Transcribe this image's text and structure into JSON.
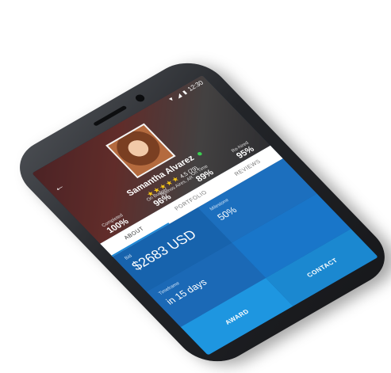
{
  "statusbar": {
    "time": "12:30"
  },
  "profile": {
    "name": "Samantha Alvarez",
    "rating_value": "4.5 (79)",
    "stars": "★★★★★",
    "subtitle": "Buenos Aires, AR"
  },
  "stats": [
    {
      "label": "Completed",
      "value": "100%"
    },
    {
      "label": "On Budget",
      "value": "96%"
    },
    {
      "label": "On Time",
      "value": "89%"
    },
    {
      "label": "Re-hired",
      "value": "95%"
    }
  ],
  "tabs": [
    "ABOUT",
    "PORTFOLIO",
    "REVIEWS"
  ],
  "details": {
    "bid_label": "Bid",
    "bid_value": "$2683 USD",
    "milestone_label": "Milestone",
    "milestone_value": "50%",
    "timeframe_label": "Timeframe",
    "timeframe_value": "in 15 days"
  },
  "actions": {
    "award": "AWARD",
    "contact": "CONTACT"
  },
  "colors": {
    "accent": "#1e96e0",
    "panel": "#1763ad",
    "online": "#3ccf52",
    "star": "#f5c518"
  }
}
